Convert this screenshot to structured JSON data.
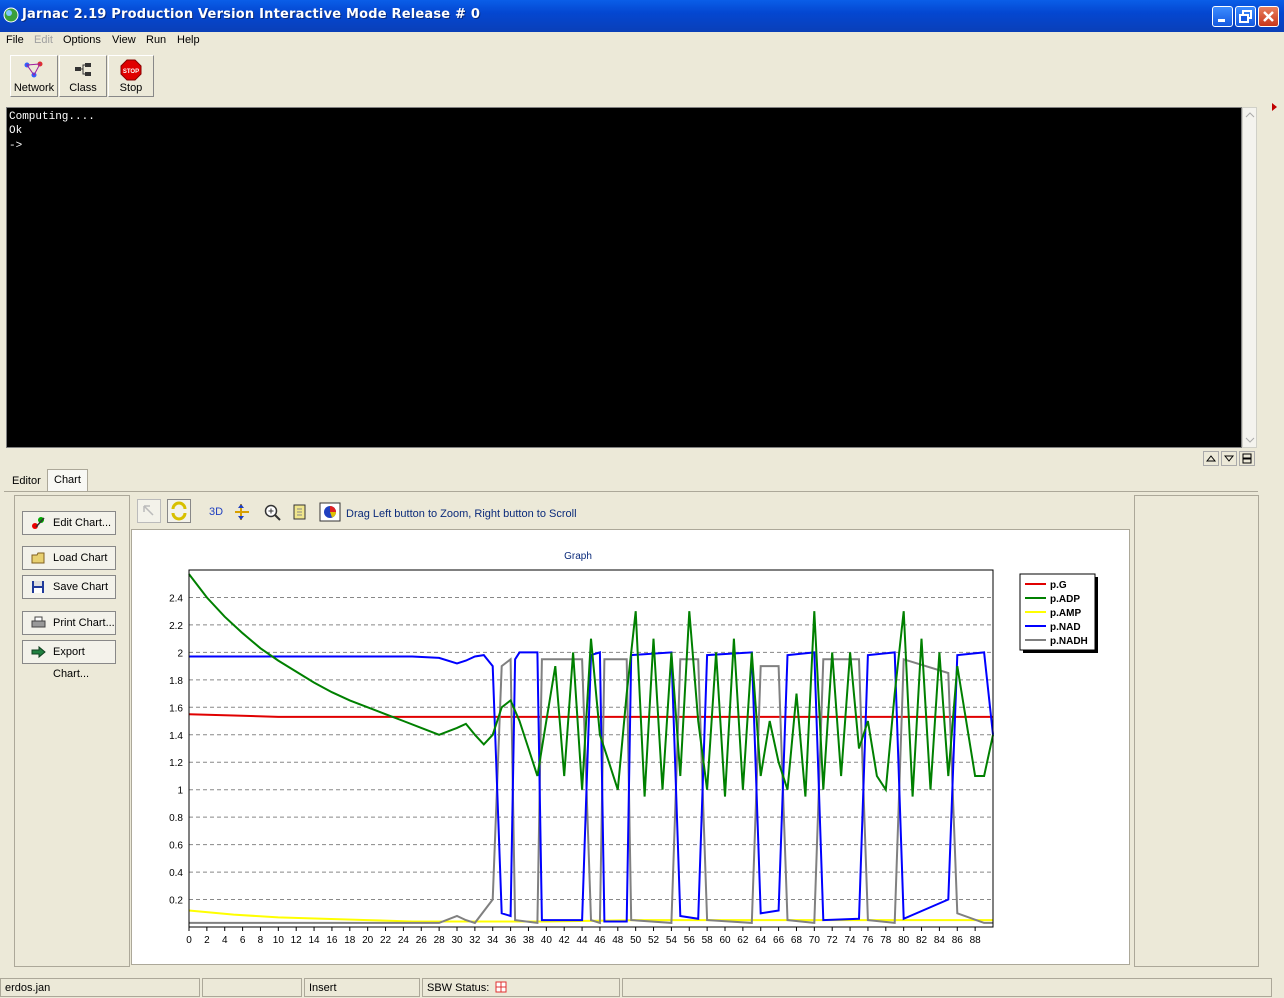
{
  "window": {
    "title": "Jarnac 2.19 Production Version Interactive Mode Release # 0"
  },
  "menu": [
    "File",
    "Edit",
    "Options",
    "View",
    "Run",
    "Help"
  ],
  "toolbar": {
    "network_label": "Network",
    "class_label": "Class",
    "stop_label": "Stop",
    "stop_sign": "STOP"
  },
  "console": {
    "lines": [
      "Computing....",
      "Ok",
      "->"
    ]
  },
  "tabs": {
    "editor": "Editor",
    "chart": "Chart"
  },
  "chart_buttons": {
    "edit": "Edit Chart...",
    "load": "Load Chart",
    "save": "Save Chart",
    "print": "Print Chart...",
    "export": "Export Chart..."
  },
  "chart_toolbar": {
    "btn_3d": "3D",
    "hint": "Drag Left button to Zoom, Right button to Scroll"
  },
  "status": {
    "file": "erdos.jan",
    "mode": "Insert",
    "sbw_label": "SBW Status:"
  },
  "chart_data": {
    "type": "line",
    "title": "Graph",
    "xlim": [
      0,
      90
    ],
    "ylim": [
      0,
      2.6
    ],
    "x_ticks": [
      0,
      2,
      4,
      6,
      8,
      10,
      12,
      14,
      16,
      18,
      20,
      22,
      24,
      26,
      28,
      30,
      32,
      34,
      36,
      38,
      40,
      42,
      44,
      46,
      48,
      50,
      52,
      54,
      56,
      58,
      60,
      62,
      64,
      66,
      68,
      70,
      72,
      74,
      76,
      78,
      80,
      82,
      84,
      86,
      88
    ],
    "y_ticks": [
      0.2,
      0.4,
      0.6,
      0.8,
      1,
      1.2,
      1.4,
      1.6,
      1.8,
      2,
      2.2,
      2.4
    ],
    "grid": "horizontal-dashed",
    "legend": "right",
    "series": [
      {
        "name": "p.G",
        "color": "#e00000",
        "points": [
          [
            0,
            1.55
          ],
          [
            5,
            1.54
          ],
          [
            10,
            1.53
          ],
          [
            20,
            1.53
          ],
          [
            30,
            1.53
          ],
          [
            40,
            1.53
          ],
          [
            50,
            1.53
          ],
          [
            60,
            1.53
          ],
          [
            70,
            1.53
          ],
          [
            80,
            1.53
          ],
          [
            90,
            1.53
          ]
        ]
      },
      {
        "name": "p.ADP",
        "color": "#008000",
        "points": [
          [
            0,
            2.57
          ],
          [
            2,
            2.4
          ],
          [
            4,
            2.26
          ],
          [
            6,
            2.14
          ],
          [
            8,
            2.03
          ],
          [
            10,
            1.94
          ],
          [
            12,
            1.86
          ],
          [
            14,
            1.78
          ],
          [
            16,
            1.71
          ],
          [
            18,
            1.65
          ],
          [
            20,
            1.6
          ],
          [
            22,
            1.55
          ],
          [
            24,
            1.5
          ],
          [
            26,
            1.45
          ],
          [
            28,
            1.4
          ],
          [
            30,
            1.45
          ],
          [
            31,
            1.48
          ],
          [
            32,
            1.4
          ],
          [
            33,
            1.33
          ],
          [
            34,
            1.4
          ],
          [
            35,
            1.6
          ],
          [
            36,
            1.65
          ],
          [
            37,
            1.5
          ],
          [
            38,
            1.3
          ],
          [
            39,
            1.1
          ],
          [
            40,
            1.5
          ],
          [
            41,
            1.9
          ],
          [
            42,
            1.1
          ],
          [
            43,
            2.0
          ],
          [
            44,
            1.0
          ],
          [
            45,
            2.1
          ],
          [
            46,
            1.4
          ],
          [
            47,
            1.2
          ],
          [
            48,
            1.0
          ],
          [
            49,
            1.7
          ],
          [
            50,
            2.3
          ],
          [
            51,
            0.95
          ],
          [
            52,
            2.1
          ],
          [
            53,
            1.0
          ],
          [
            54,
            2.0
          ],
          [
            55,
            1.1
          ],
          [
            56,
            2.3
          ],
          [
            57,
            1.5
          ],
          [
            58,
            1.0
          ],
          [
            59,
            2.0
          ],
          [
            60,
            0.95
          ],
          [
            61,
            2.1
          ],
          [
            62,
            1.0
          ],
          [
            63,
            2.0
          ],
          [
            64,
            1.1
          ],
          [
            65,
            1.5
          ],
          [
            66,
            1.2
          ],
          [
            67,
            1.0
          ],
          [
            68,
            1.7
          ],
          [
            69,
            0.95
          ],
          [
            70,
            2.3
          ],
          [
            71,
            1.0
          ],
          [
            72,
            2.0
          ],
          [
            73,
            1.1
          ],
          [
            74,
            2.0
          ],
          [
            75,
            1.3
          ],
          [
            76,
            1.5
          ],
          [
            77,
            1.1
          ],
          [
            78,
            1.0
          ],
          [
            79,
            1.7
          ],
          [
            80,
            2.3
          ],
          [
            81,
            0.95
          ],
          [
            82,
            2.1
          ],
          [
            83,
            1.0
          ],
          [
            84,
            2.0
          ],
          [
            85,
            1.1
          ],
          [
            86,
            1.9
          ],
          [
            87,
            1.5
          ],
          [
            88,
            1.1
          ],
          [
            89,
            1.1
          ],
          [
            90,
            1.4
          ]
        ]
      },
      {
        "name": "p.AMP",
        "color": "#ffff00",
        "points": [
          [
            0,
            0.12
          ],
          [
            5,
            0.09
          ],
          [
            10,
            0.07
          ],
          [
            15,
            0.06
          ],
          [
            20,
            0.05
          ],
          [
            25,
            0.04
          ],
          [
            30,
            0.04
          ],
          [
            35,
            0.04
          ],
          [
            40,
            0.04
          ],
          [
            50,
            0.05
          ],
          [
            60,
            0.05
          ],
          [
            70,
            0.05
          ],
          [
            80,
            0.05
          ],
          [
            90,
            0.05
          ]
        ]
      },
      {
        "name": "p.NAD",
        "color": "#0000ff",
        "points": [
          [
            0,
            1.97
          ],
          [
            5,
            1.97
          ],
          [
            10,
            1.97
          ],
          [
            15,
            1.97
          ],
          [
            20,
            1.97
          ],
          [
            25,
            1.97
          ],
          [
            28,
            1.96
          ],
          [
            30,
            1.92
          ],
          [
            31,
            1.94
          ],
          [
            32,
            1.97
          ],
          [
            33,
            1.98
          ],
          [
            34,
            1.9
          ],
          [
            35,
            0.1
          ],
          [
            36,
            0.08
          ],
          [
            36.5,
            1.95
          ],
          [
            37,
            2.0
          ],
          [
            39,
            2.0
          ],
          [
            39.5,
            0.05
          ],
          [
            44,
            0.05
          ],
          [
            45,
            1.98
          ],
          [
            46,
            2.0
          ],
          [
            46.5,
            0.04
          ],
          [
            49,
            0.04
          ],
          [
            49.5,
            1.98
          ],
          [
            54,
            2.0
          ],
          [
            55,
            0.08
          ],
          [
            57,
            0.06
          ],
          [
            58,
            1.98
          ],
          [
            63,
            2.0
          ],
          [
            64,
            0.1
          ],
          [
            66,
            0.12
          ],
          [
            67,
            1.98
          ],
          [
            70,
            2.0
          ],
          [
            71,
            0.05
          ],
          [
            75,
            0.06
          ],
          [
            76,
            1.98
          ],
          [
            79,
            2.0
          ],
          [
            80,
            0.06
          ],
          [
            85,
            0.2
          ],
          [
            86,
            1.98
          ],
          [
            89,
            2.0
          ],
          [
            90,
            1.4
          ]
        ]
      },
      {
        "name": "p.NADH",
        "color": "#808080",
        "points": [
          [
            0,
            0.03
          ],
          [
            10,
            0.03
          ],
          [
            20,
            0.03
          ],
          [
            28,
            0.03
          ],
          [
            30,
            0.08
          ],
          [
            31,
            0.05
          ],
          [
            32,
            0.03
          ],
          [
            34,
            0.2
          ],
          [
            35,
            1.9
          ],
          [
            36,
            1.95
          ],
          [
            36.5,
            0.05
          ],
          [
            39,
            0.03
          ],
          [
            39.5,
            1.95
          ],
          [
            44,
            1.95
          ],
          [
            45,
            0.05
          ],
          [
            46,
            0.03
          ],
          [
            46.5,
            1.95
          ],
          [
            49,
            1.95
          ],
          [
            49.5,
            0.05
          ],
          [
            54,
            0.03
          ],
          [
            55,
            1.95
          ],
          [
            57,
            1.95
          ],
          [
            58,
            0.05
          ],
          [
            63,
            0.03
          ],
          [
            64,
            1.9
          ],
          [
            66,
            1.9
          ],
          [
            67,
            0.05
          ],
          [
            70,
            0.03
          ],
          [
            71,
            1.95
          ],
          [
            75,
            1.95
          ],
          [
            76,
            0.05
          ],
          [
            79,
            0.03
          ],
          [
            80,
            1.95
          ],
          [
            85,
            1.85
          ],
          [
            86,
            0.1
          ],
          [
            89,
            0.03
          ],
          [
            90,
            0.03
          ]
        ]
      }
    ]
  }
}
